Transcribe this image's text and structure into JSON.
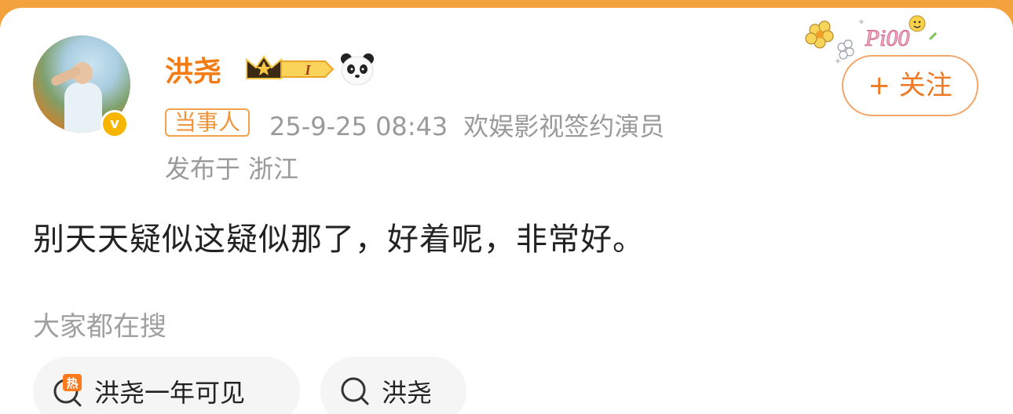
{
  "post": {
    "author_name": "洪尧",
    "level_badge": "I",
    "role_tag": "当事人",
    "timestamp": "25-9-25 08:43",
    "company": "欢娱影视签约演员",
    "location": "发布于 浙江",
    "follow_label": "+ 关注",
    "sticker_text": "Pi00",
    "content": "别天天疑似这疑似那了，好着呢，非常好。"
  },
  "search": {
    "section_label": "大家都在搜",
    "hot_badge": "热",
    "chips": [
      {
        "label": "洪尧一年可见",
        "hot": true
      },
      {
        "label": "洪尧",
        "hot": false
      }
    ]
  },
  "colors": {
    "accent": "#f27c13",
    "top_bar": "#f4a23e",
    "tag_border": "#f2a24a",
    "meta_gray": "#9a9a9a",
    "chip_bg": "#f5f5f5"
  }
}
